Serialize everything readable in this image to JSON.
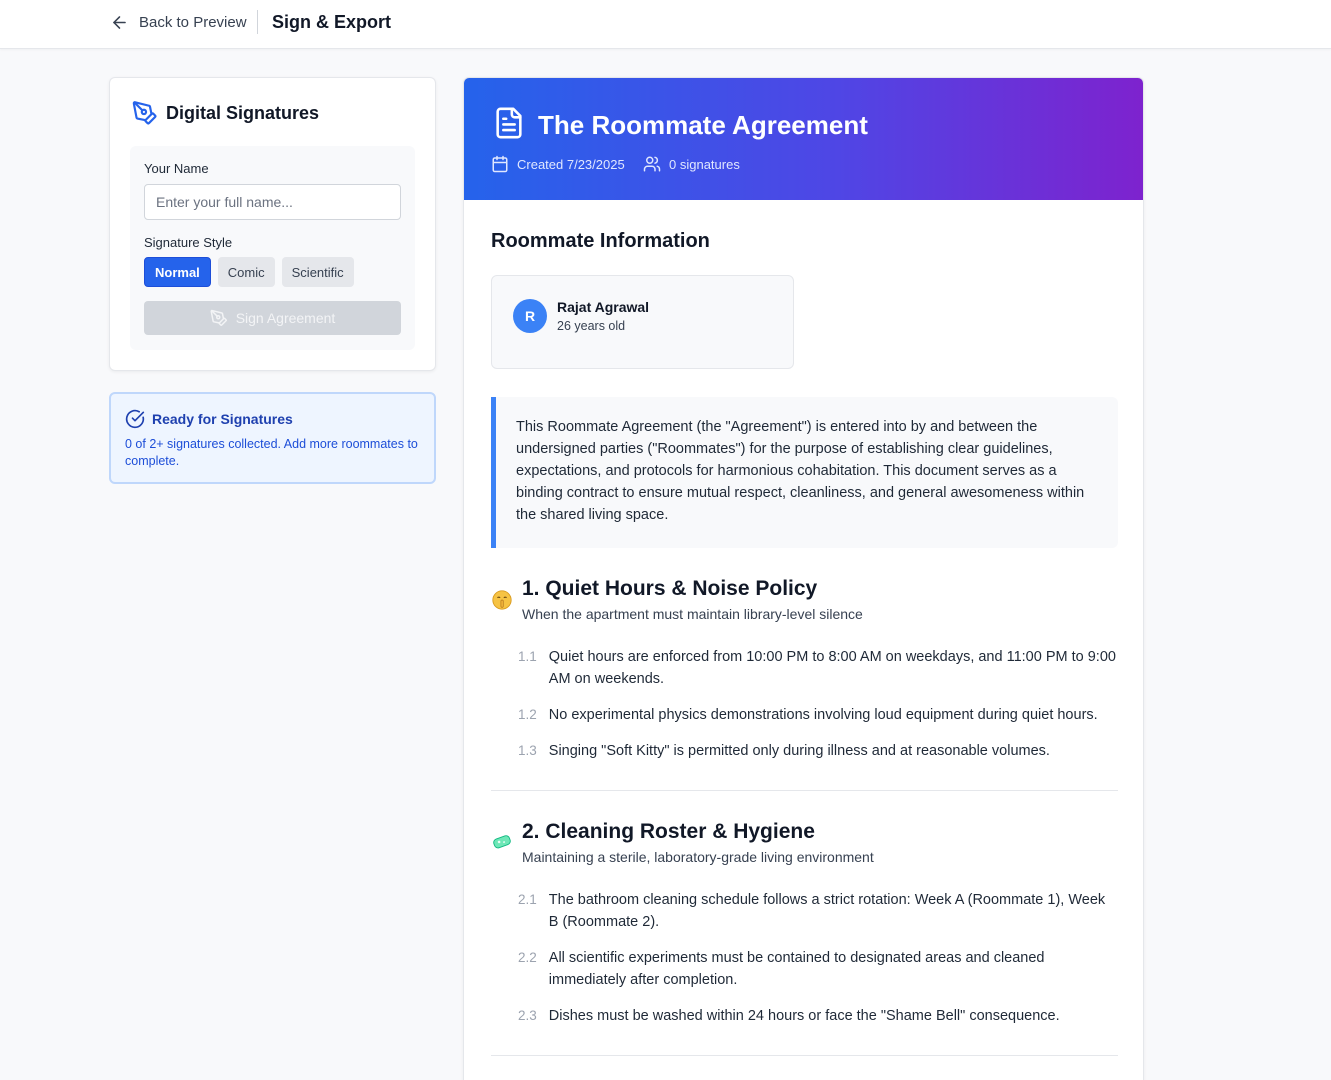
{
  "topbar": {
    "back_label": "Back to Preview",
    "title": "Sign & Export"
  },
  "signatures_panel": {
    "title": "Digital Signatures",
    "name_label": "Your Name",
    "name_value": "",
    "name_placeholder": "Enter your full name...",
    "style_label": "Signature Style",
    "styles": [
      "Normal",
      "Comic",
      "Scientific"
    ],
    "selected_style": "Normal",
    "sign_button": "Sign Agreement"
  },
  "ready_panel": {
    "title": "Ready for Signatures",
    "text": "0 of 2+ signatures collected. Add more roommates to complete."
  },
  "document": {
    "title": "The Roommate Agreement",
    "created": "Created 7/23/2025",
    "signatures": "0 signatures",
    "roommate_info_title": "Roommate Information",
    "roommate": {
      "initial": "R",
      "name": "Rajat Agrawal",
      "age": "26 years old"
    },
    "intro": "This Roommate Agreement (the \"Agreement\") is entered into by and between the undersigned parties (\"Roommates\") for the purpose of establishing clear guidelines, expectations, and protocols for harmonious cohabitation. This document serves as a binding contract to ensure mutual respect, cleanliness, and general awesomeness within the shared living space.",
    "sections": [
      {
        "emoji": "shushing-face-icon",
        "title": "1. Quiet Hours & Noise Policy",
        "subtitle": "When the apartment must maintain library-level silence",
        "clauses": [
          {
            "num": "1.1",
            "text": "Quiet hours are enforced from 10:00 PM to 8:00 AM on weekdays, and 11:00 PM to 9:00 AM on weekends."
          },
          {
            "num": "1.2",
            "text": "No experimental physics demonstrations involving loud equipment during quiet hours."
          },
          {
            "num": "1.3",
            "text": "Singing \"Soft Kitty\" is permitted only during illness and at reasonable volumes."
          }
        ]
      },
      {
        "emoji": "soap-icon",
        "title": "2. Cleaning Roster & Hygiene",
        "subtitle": "Maintaining a sterile, laboratory-grade living environment",
        "clauses": [
          {
            "num": "2.1",
            "text": "The bathroom cleaning schedule follows a strict rotation: Week A (Roommate 1), Week B (Roommate 2)."
          },
          {
            "num": "2.2",
            "text": "All scientific experiments must be contained to designated areas and cleaned immediately after completion."
          },
          {
            "num": "2.3",
            "text": "Dishes must be washed within 24 hours or face the \"Shame Bell\" consequence."
          }
        ]
      }
    ]
  },
  "colors": {
    "primary": "#2563eb",
    "banner_start": "#2563eb",
    "banner_end": "#7e22ce",
    "ready_bg": "#eef5ff"
  }
}
